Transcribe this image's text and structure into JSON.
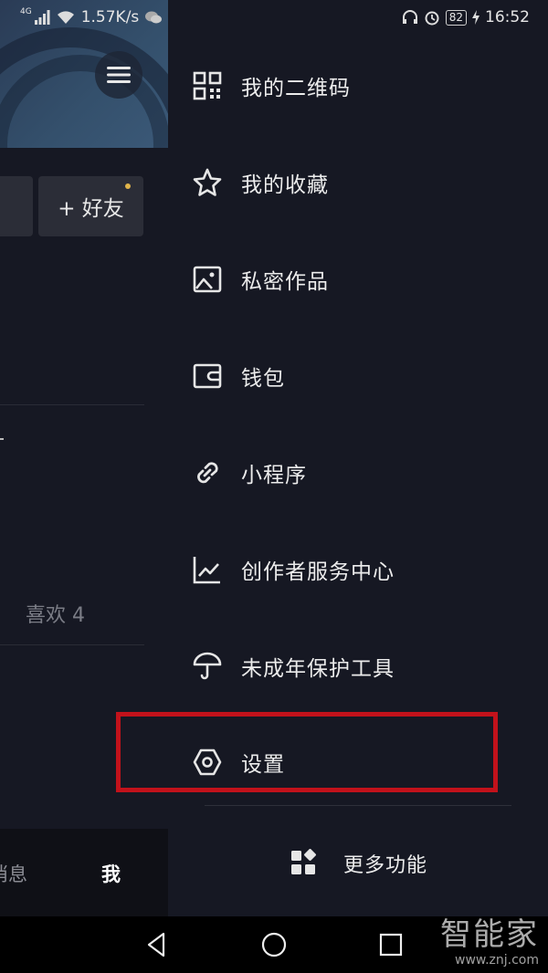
{
  "status_bar": {
    "network_tag": "4G",
    "speed": "1.57K/s",
    "battery": "82",
    "time": "16:52"
  },
  "background_page": {
    "add_friend_label": "+ 好友",
    "likes_tab": "喜欢 4",
    "nav_messages": "消息",
    "nav_me": "我"
  },
  "drawer": {
    "items": [
      {
        "label": "我的二维码",
        "icon": "qr-code-icon"
      },
      {
        "label": "我的收藏",
        "icon": "star-icon"
      },
      {
        "label": "私密作品",
        "icon": "image-icon"
      },
      {
        "label": "钱包",
        "icon": "wallet-icon"
      },
      {
        "label": "小程序",
        "icon": "link-icon"
      },
      {
        "label": "创作者服务中心",
        "icon": "chart-icon"
      },
      {
        "label": "未成年保护工具",
        "icon": "umbrella-icon"
      },
      {
        "label": "设置",
        "icon": "settings-hexagon-icon"
      }
    ],
    "more_label": "更多功能"
  },
  "watermark": {
    "main": "智能家",
    "sub": "www.znj.com"
  },
  "colors": {
    "background": "#161823",
    "highlight": "#c2121b"
  }
}
